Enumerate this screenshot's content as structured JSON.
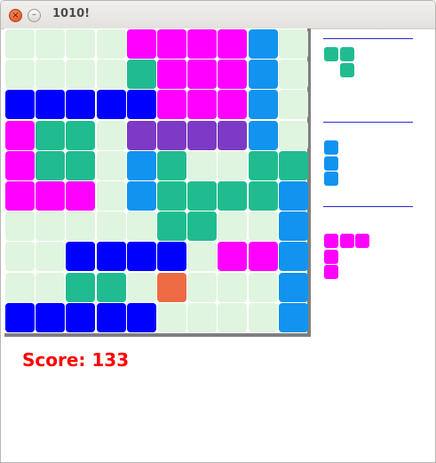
{
  "window": {
    "title": "1010!",
    "close_glyph": "×",
    "minimize_glyph": "–"
  },
  "colors": {
    "E": "#dff5df",
    "M": "#ff00ff",
    "L": "#1193ef",
    "T": "#20bc90",
    "B": "#0000ff",
    "P": "#7d3ac4",
    "O": "#ee6a42"
  },
  "board": {
    "size": 10,
    "rows": [
      "EEEEMMMMLE",
      "EEEETMMMLE",
      "BBBBBMMMLE",
      "MTTEPPPPLE",
      "MTTELTEETT",
      "MMMELTTTTL",
      "EEEEETTEEL",
      "EEBBBBEMML",
      "EETTEOEEEL",
      "BBBBBEEEEL"
    ]
  },
  "pieces": [
    {
      "name": "s-tetromino-piece",
      "color": "T",
      "cells": [
        [
          0,
          0
        ],
        [
          1,
          0
        ],
        [
          1,
          1
        ]
      ]
    },
    {
      "name": "vertical-three-piece",
      "color": "L",
      "cells": [
        [
          0,
          0
        ],
        [
          0,
          1
        ],
        [
          0,
          2
        ]
      ]
    },
    {
      "name": "corner-piece",
      "color": "M",
      "cells": [
        [
          0,
          0
        ],
        [
          1,
          0
        ],
        [
          2,
          0
        ],
        [
          0,
          1
        ],
        [
          0,
          2
        ]
      ]
    }
  ],
  "score": {
    "text": "Score: 133"
  }
}
